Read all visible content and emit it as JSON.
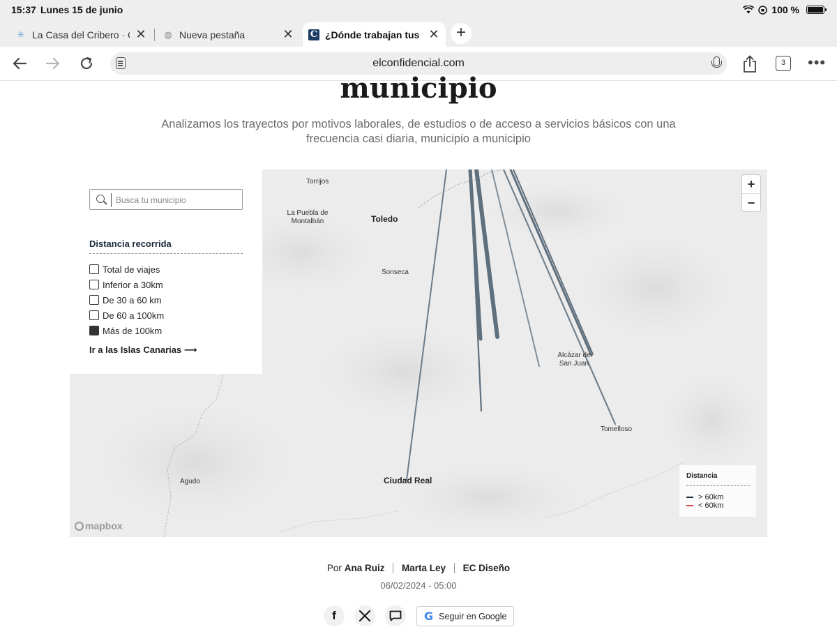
{
  "status": {
    "time": "15:37",
    "date": "Lunes 15 de junio",
    "battery": "100 %"
  },
  "tabs": [
    {
      "title": "La Casa del Cribero · Ca",
      "icon": "loading-icon"
    },
    {
      "title": "Nueva pestaña",
      "icon": "globe-icon"
    },
    {
      "title": "¿Dónde trabajan tus ve",
      "icon": "elconfidencial-icon",
      "active": true
    }
  ],
  "nav": {
    "url": "elconfidencial.com",
    "tab_count": "3"
  },
  "article": {
    "headline": "municipio",
    "subtitle": "Analizamos los trayectos por motivos laborales, de estudios o de acceso a servicios básicos con una frecuencia casi diaria, municipio a municipio"
  },
  "map": {
    "search_placeholder": "Busca tu municipio",
    "distance_title": "Distancia recorrida",
    "filters": [
      {
        "label": "Total de viajes",
        "checked": false
      },
      {
        "label": "Inferior a 30km",
        "checked": false
      },
      {
        "label": "De 30 a 60 km",
        "checked": false
      },
      {
        "label": "De 60 a 100km",
        "checked": false
      },
      {
        "label": "Más de 100km",
        "checked": true
      }
    ],
    "canarias_link": "Ir a las Islas Canarias ⟶",
    "zoom_in": "+",
    "zoom_out": "−",
    "places": {
      "torrijos": "Torrijos",
      "puebla": "La Puebla de",
      "montalban": "Montalbán",
      "toledo": "Toledo",
      "sonseca": "Sonseca",
      "alcazar_1": "Alcázar de",
      "alcazar_2": "San Juan",
      "tomelloso": "Tomelloso",
      "ciudad_real": "Ciudad Real",
      "agudo": "Agudo"
    },
    "legend": {
      "title": "Distancia",
      "items": [
        {
          "label": "> 60km",
          "color": "#1c2b3a"
        },
        {
          "label": "< 60km",
          "color": "#d94a4a"
        }
      ]
    },
    "attribution": "mapbox",
    "line_color": "#5e6f7d"
  },
  "byline": {
    "prefix": "Por",
    "authors": [
      "Ana Ruiz",
      "Marta Ley",
      "EC Diseño"
    ],
    "date": "06/02/2024 - 05:00"
  },
  "share": {
    "facebook": "f",
    "x": "𝕏",
    "comments": "comments",
    "follow_google": "Seguir en Google",
    "g_letter": "G"
  }
}
